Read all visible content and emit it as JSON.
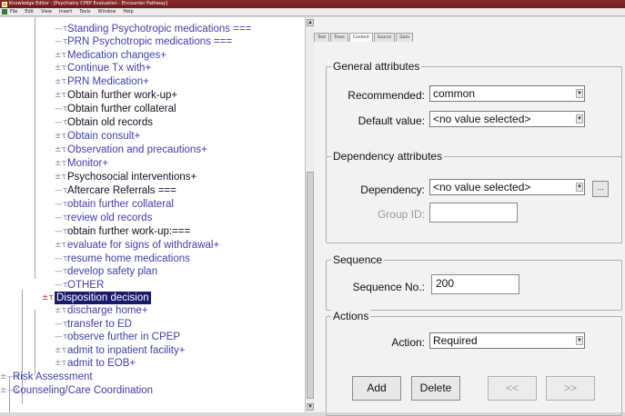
{
  "window": {
    "title": "Knowledge Editor - [Psychiatry CPEP Evaluation - Encounter Pathway]"
  },
  "menu": [
    "File",
    "Edit",
    "View",
    "Insert",
    "Tools",
    "Window",
    "Help"
  ],
  "tree": {
    "items": [
      {
        "label": "Standing Psychotropic medications ===",
        "style": "normal"
      },
      {
        "label": "PRN Psychotropic medications ===",
        "style": "normal"
      },
      {
        "label": "Medication changes+",
        "style": "normal"
      },
      {
        "label": "Continue Tx with+",
        "style": "normal"
      },
      {
        "label": "PRN Medication+",
        "style": "normal"
      },
      {
        "label": "Obtain further work-up+",
        "style": "dark"
      },
      {
        "label": "Obtain further collateral",
        "style": "dark"
      },
      {
        "label": "Obtain old records",
        "style": "dark"
      },
      {
        "label": "Obtain consult+",
        "style": "normal"
      },
      {
        "label": "Observation and precautions+",
        "style": "normal"
      },
      {
        "label": "Monitor+",
        "style": "normal"
      },
      {
        "label": "Psychosocial interventions+",
        "style": "dark"
      },
      {
        "label": "Aftercare Referrals ===",
        "style": "dark"
      },
      {
        "label": "obtain further collateral",
        "style": "normal"
      },
      {
        "label": "review old records",
        "style": "normal"
      },
      {
        "label": "obtain further work-up:===",
        "style": "dark"
      },
      {
        "label": "evaluate for signs of withdrawal+",
        "style": "normal"
      },
      {
        "label": "resume home medications",
        "style": "normal"
      },
      {
        "label": "develop safety plan",
        "style": "normal"
      },
      {
        "label": "OTHER",
        "style": "normal"
      },
      {
        "label": "Disposition decision",
        "style": "selected"
      },
      {
        "label": "discharge home+",
        "style": "normal"
      },
      {
        "label": "transfer to ED",
        "style": "normal"
      },
      {
        "label": "observe further in CPEP",
        "style": "normal"
      },
      {
        "label": "admit to inpatient facility+",
        "style": "normal"
      },
      {
        "label": "admit to EOB+",
        "style": "normal"
      },
      {
        "label": "Risk Assessment",
        "style": "normal"
      },
      {
        "label": "Counseling/Care Coordination",
        "style": "normal"
      }
    ]
  },
  "tabs": [
    "Text",
    "Trees",
    "Content",
    "Source",
    "Data"
  ],
  "general": {
    "title": "General attributes",
    "recommended_label": "Recommended:",
    "recommended_value": "common",
    "default_label": "Default value:",
    "default_value": "<no value selected>"
  },
  "dependency": {
    "title": "Dependency attributes",
    "dependency_label": "Dependency:",
    "dependency_value": "<no value selected>",
    "ellipsis": "...",
    "group_label": "Group ID:",
    "group_value": ""
  },
  "sequence": {
    "title": "Sequence",
    "label": "Sequence No.:",
    "value": "200"
  },
  "actions": {
    "title": "Actions",
    "label": "Action:",
    "value": "Required",
    "add": "Add",
    "delete": "Delete",
    "prev": "<<",
    "next": ">>"
  }
}
